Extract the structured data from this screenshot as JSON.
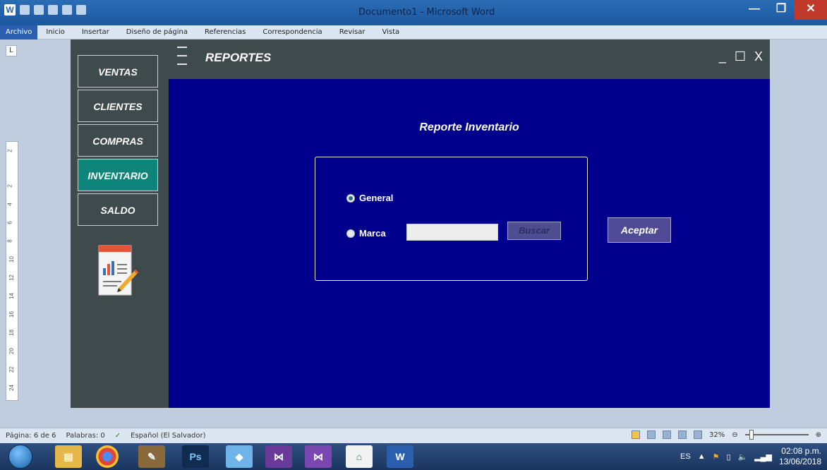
{
  "word": {
    "title": "Documento1 - Microsoft Word",
    "tabs": [
      "Archivo",
      "Inicio",
      "Insertar",
      "Diseño de página",
      "Referencias",
      "Correspondencia",
      "Revisar",
      "Vista"
    ],
    "tab_marker": "L",
    "ruler_numbers": [
      "2",
      "2",
      "4",
      "6",
      "8",
      "10",
      "12",
      "14",
      "16",
      "18",
      "20",
      "22",
      "24"
    ]
  },
  "app": {
    "topbar_title": "REPORTES",
    "minimize": "_",
    "maximize": "☐",
    "close": "X",
    "nav": [
      {
        "label": "VENTAS",
        "active": false
      },
      {
        "label": "CLIENTES",
        "active": false
      },
      {
        "label": "COMPRAS",
        "active": false
      },
      {
        "label": "INVENTARIO",
        "active": true
      },
      {
        "label": "SALDO",
        "active": false
      }
    ],
    "report_title": "Reporte Inventario",
    "option_general": "General",
    "option_marca": "Marca",
    "marca_value": "",
    "buscar_label": "Buscar",
    "aceptar_label": "Aceptar"
  },
  "status": {
    "page": "Página: 6 de 6",
    "words": "Palabras: 0",
    "language": "Español (El Salvador)",
    "zoom": "32%"
  },
  "taskbar": {
    "lang": "ES",
    "time": "02:08 p.m.",
    "date": "13/06/2018"
  },
  "colors": {
    "content_bg": "#00008c",
    "sidebar_bg": "#3f4a4d",
    "active_nav": "#0d857a"
  }
}
